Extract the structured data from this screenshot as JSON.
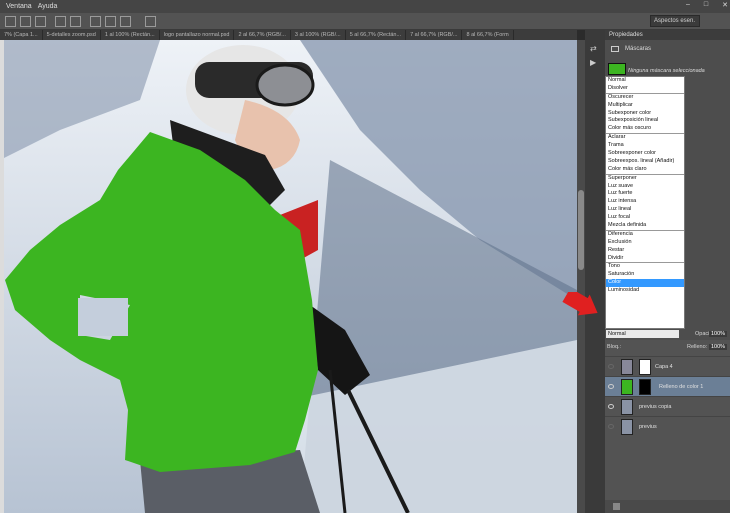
{
  "menu": {
    "items": [
      "Ventana",
      "Ayuda"
    ]
  },
  "workspace": {
    "label": "Aspectos esen."
  },
  "tabs": [
    "7% (Capa 1...",
    "5-detalles zoom.psd",
    "1 al 100% (Rectán...",
    "logo pantallazo normal.psd",
    "2 al 66,7% (RGB/...",
    "3 al 100% (RGB/...",
    "5 al 66,7% (Rectán...",
    "7 al 66,7% (RGB/...",
    "8 al 66,7% (Form"
  ],
  "properties": {
    "title": "Propiedades",
    "section": "Máscaras",
    "mask_status": "Ninguna máscara seleccionada"
  },
  "blend_groups": [
    [
      "Normal",
      "Disolver"
    ],
    [
      "Oscurecer",
      "Multiplicar",
      "Subexponer color",
      "Subexposición lineal",
      "Color más oscuro"
    ],
    [
      "Aclarar",
      "Trama",
      "Sobreexponer color",
      "Sobreexpos. lineal (Añadir)",
      "Color más claro"
    ],
    [
      "Superponer",
      "Luz suave",
      "Luz fuerte",
      "Luz intensa",
      "Luz lineal",
      "Luz focal",
      "Mezcla definida"
    ],
    [
      "Diferencia",
      "Exclusión",
      "Restar",
      "Dividir"
    ],
    [
      "Tono",
      "Saturación",
      "Color",
      "Luminosidad"
    ]
  ],
  "blend_selected": "Color",
  "blend_mode_value": "Normal",
  "opacity": {
    "label": "Opacidad:",
    "value": "100%"
  },
  "fill": {
    "label": "Relleno:",
    "value": "100%"
  },
  "lock_label": "Bloq.:",
  "layers": [
    {
      "name": "Capa 4"
    },
    {
      "name": "Relleno de color 1"
    },
    {
      "name": "previus copia"
    },
    {
      "name": "previus"
    }
  ],
  "colors": {
    "green_fill": "#3cb521",
    "selection_blue": "#3399ff",
    "arrow_red": "#e02020"
  }
}
